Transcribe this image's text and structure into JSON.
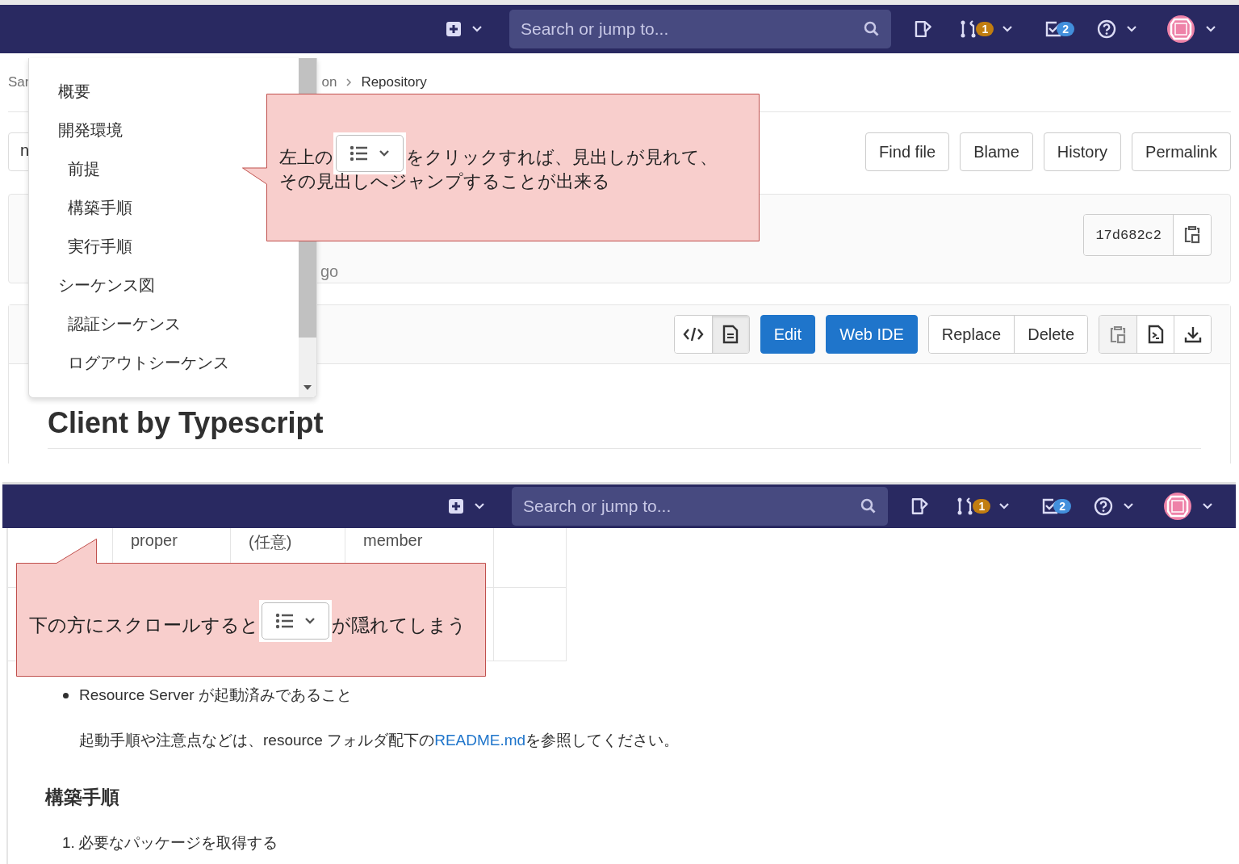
{
  "screens": [
    {
      "kind": "file_view",
      "navbar": {
        "search": {
          "placeholder": "Search or jump to..."
        },
        "merge_requests_badge": "1",
        "todos_badge": "2"
      },
      "breadcrumb": [
        "Sar",
        "on",
        "Repository"
      ],
      "branch_field": {
        "value": "n"
      },
      "file_actions": [
        "Find file",
        "Blame",
        "History",
        "Permalink"
      ],
      "commit": {
        "time_fragment": "go",
        "sha": "17d682c2"
      },
      "file_header": {
        "viewer_toggle": [
          {
            "kind": "source",
            "selected": false
          },
          {
            "kind": "rendered",
            "selected": true
          }
        ],
        "primary_buttons": [
          "Edit",
          "Web IDE"
        ],
        "secondary_buttons": [
          "Replace",
          "Delete"
        ]
      },
      "heading": "Client by Typescript",
      "toc_dropdown": {
        "items": [
          {
            "label": "概要"
          },
          {
            "label": "開発環境",
            "children": [
              {
                "label": "前提"
              },
              {
                "label": "構築手順"
              },
              {
                "label": "実行手順"
              }
            ]
          },
          {
            "label": "シーケンス図",
            "children": [
              {
                "label": "認証シーケンス"
              },
              {
                "label": "ログアウトシーケンス"
              }
            ]
          }
        ]
      },
      "callout": {
        "text_before": "左上の",
        "text_after": "をクリックすれば、見出しが見れて、",
        "text_continued": "その見出しへジャンプすることが出来る"
      }
    },
    {
      "kind": "scrolled_readme",
      "navbar": {
        "search": {
          "placeholder": "Search or jump to..."
        },
        "merge_requests_badge": "1",
        "todos_badge": "2"
      },
      "table": {
        "rows": [
          {
            "column_2": "proper",
            "column_3": "(任意)",
            "column_4": "member"
          }
        ]
      },
      "bullets": [
        "Resource Server が起動済みであること"
      ],
      "note": {
        "text_before": "起動手順や注意点などは、resource フォルダ配下の",
        "link": "README.md",
        "text_after": "を参照してください。"
      },
      "section_heading": "構築手順",
      "steps": [
        {
          "number": "1.",
          "text": "必要なパッケージを取得する"
        }
      ],
      "callout": {
        "text_before": "下の方にスクロールすると",
        "text_after": "が隠れてしまう"
      }
    }
  ]
}
